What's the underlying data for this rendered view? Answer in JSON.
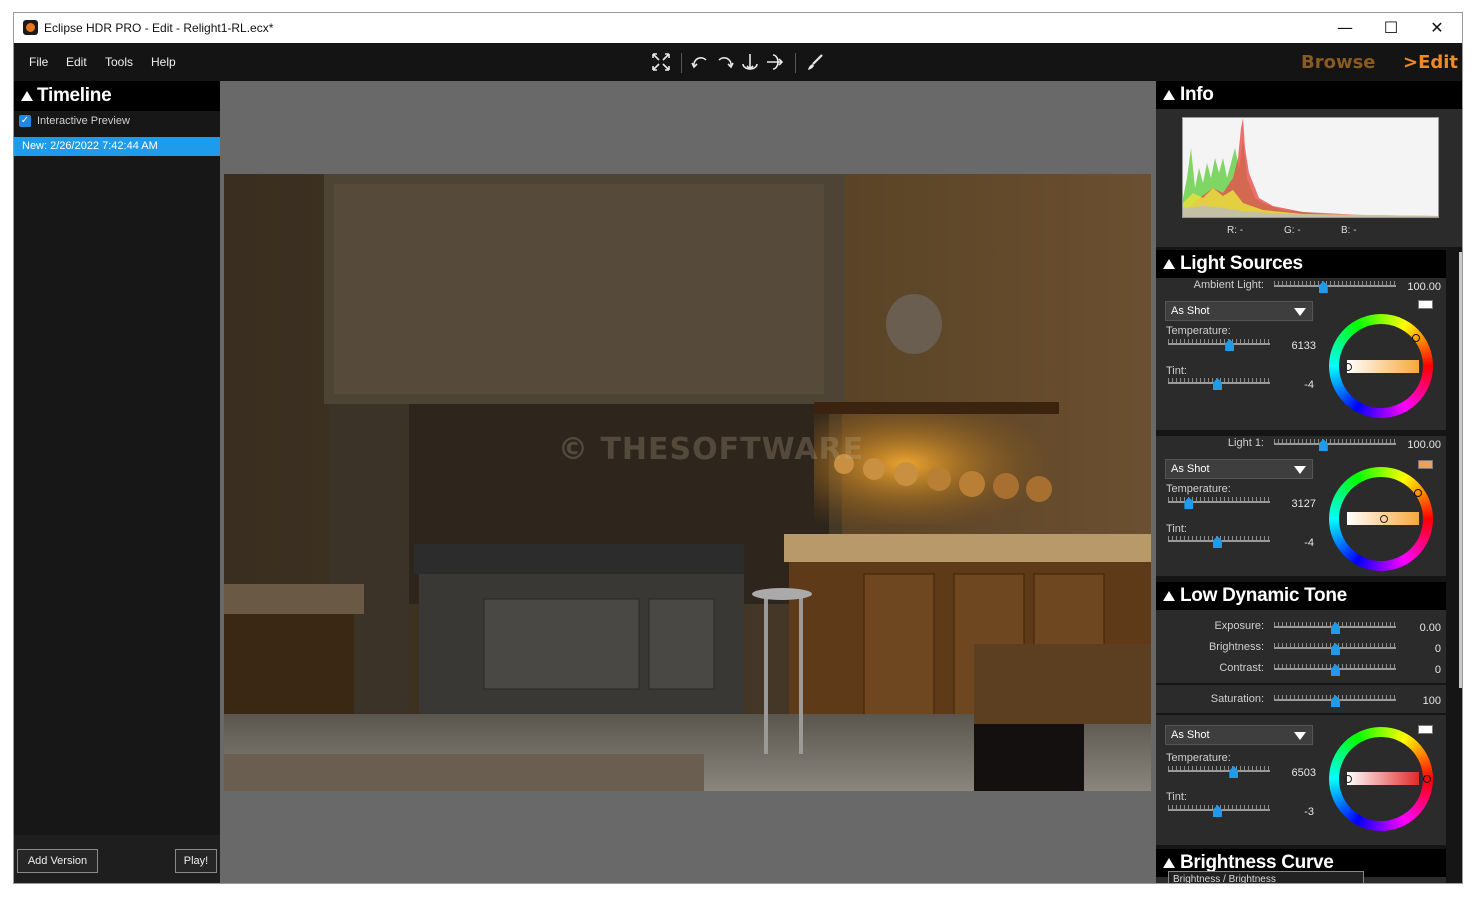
{
  "window": {
    "title": "Eclipse HDR PRO - Edit - Relight1-RL.ecx*",
    "minimize_glyph": "—",
    "maximize_glyph": "☐",
    "close_glyph": "✕"
  },
  "menu": [
    "File",
    "Edit",
    "Tools",
    "Help"
  ],
  "toolbar_icons": [
    "fit-screen-icon",
    "rotate-left-icon",
    "rotate-right-icon",
    "flip-vertical-icon",
    "flip-horizontal-icon",
    "brush-icon"
  ],
  "modes": {
    "browse": "Browse",
    "edit": ">Edit",
    "browse_color": "#8a5a20",
    "edit_color": "#f08a24"
  },
  "timeline": {
    "title": "Timeline",
    "interactive_preview_label": "Interactive Preview",
    "interactive_preview_checked": true,
    "entries": [
      "New: 2/26/2022 7:42:44 AM"
    ],
    "add_version_label": "Add Version",
    "play_label": "Play!"
  },
  "canvas": {
    "watermark": "© THESOFTWARE"
  },
  "info": {
    "title": "Info",
    "r_label": "R: -",
    "g_label": "G: -",
    "b_label": "B: -"
  },
  "light_sources": {
    "title": "Light Sources",
    "ambient": {
      "label": "Ambient Light:",
      "value": "100.00",
      "level": 0.4,
      "preset": "As Shot",
      "swatch_color": "#ffffff",
      "temperature_label": "Temperature:",
      "temperature": "6133",
      "temperature_level": 0.6,
      "tint_label": "Tint:",
      "tint": "-4",
      "tint_level": 0.48
    },
    "light1": {
      "label": "Light 1:",
      "value": "100.00",
      "level": 0.4,
      "preset": "As Shot",
      "swatch_color": "#f0a050",
      "temperature_label": "Temperature:",
      "temperature": "3127",
      "temperature_level": 0.2,
      "tint_label": "Tint:",
      "tint": "-4",
      "tint_level": 0.48
    }
  },
  "low_dynamic_tone": {
    "title": "Low Dynamic Tone",
    "exposure_label": "Exposure:",
    "exposure": "0.00",
    "exposure_level": 0.5,
    "brightness_label": "Brightness:",
    "brightness": "0",
    "brightness_level": 0.5,
    "contrast_label": "Contrast:",
    "contrast": "0",
    "contrast_level": 0.5,
    "saturation_label": "Saturation:",
    "saturation": "100",
    "saturation_level": 0.5,
    "preset": "As Shot",
    "swatch_color": "#ffffff",
    "temperature_label": "Temperature:",
    "temperature": "6503",
    "temperature_level": 0.64,
    "tint_label": "Tint:",
    "tint": "-3",
    "tint_level": 0.48
  },
  "brightness_curve": {
    "title": "Brightness Curve",
    "mode": "Brightness / Brightness"
  }
}
